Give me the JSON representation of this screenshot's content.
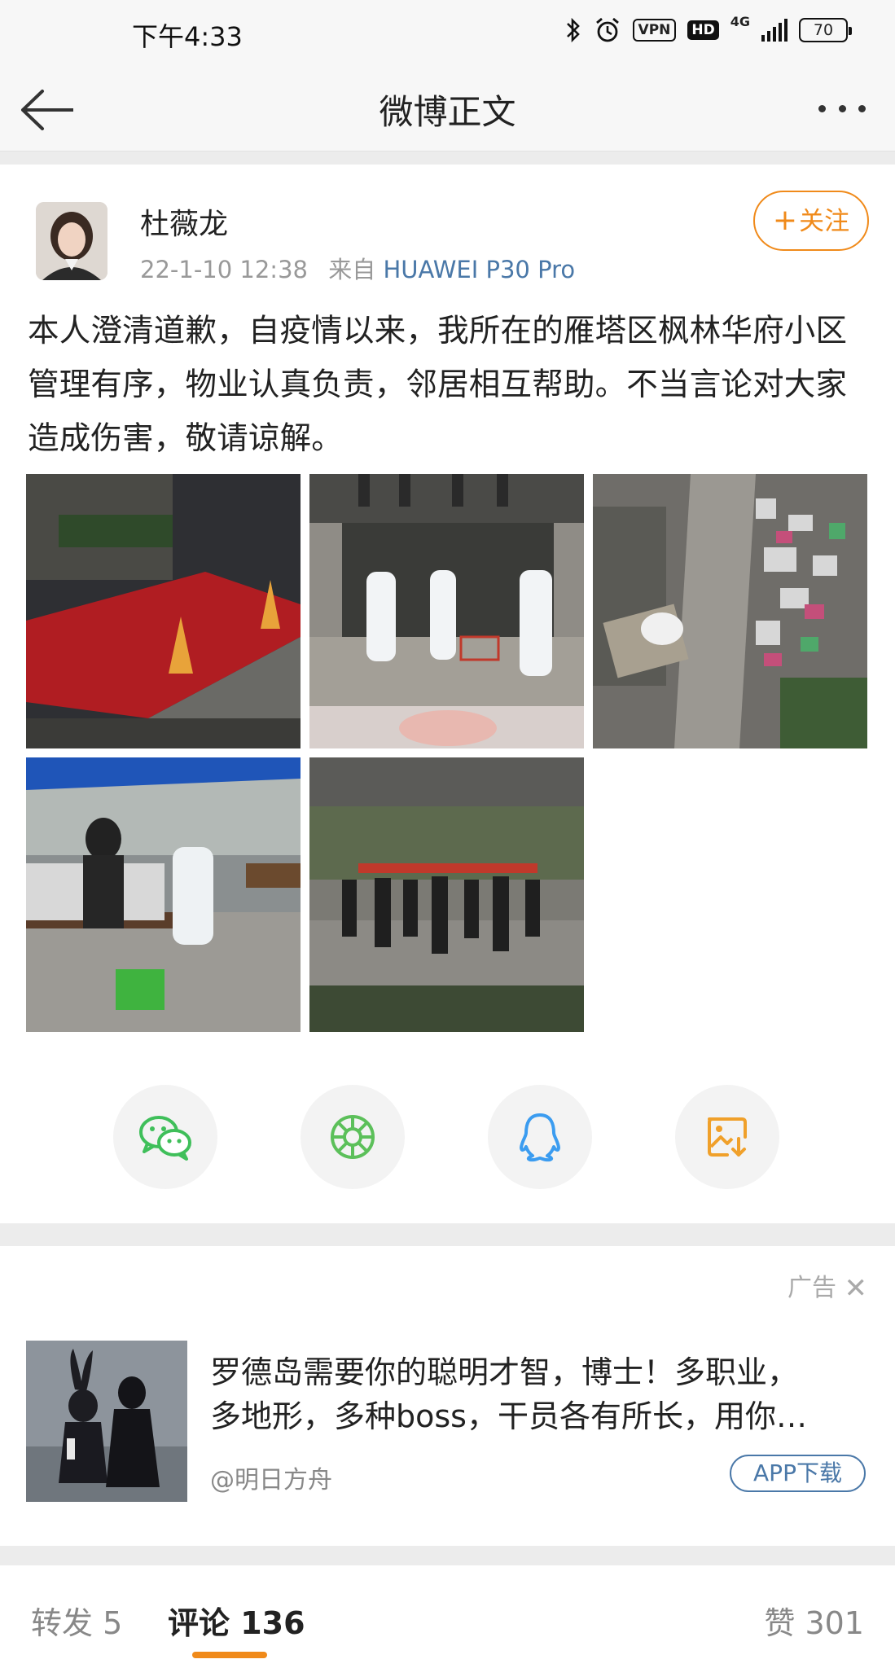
{
  "status_bar": {
    "time": "下午4:33",
    "vpn": "VPN",
    "hd": "HD",
    "network": "4G",
    "battery": "70"
  },
  "nav": {
    "title": "微博正文"
  },
  "post": {
    "author": "杜薇龙",
    "date": "22-1-10 12:38",
    "source_prefix": "来自",
    "device": "HUAWEI P30 Pro",
    "follow_label": "关注",
    "text": "本人澄清道歉，自疫情以来，我所在的雁塔区枫林华府小区管理有序，物业认真负责，邻居相互帮助。不当言论对大家造成伤害，敬请谅解。",
    "photo_count": 5
  },
  "share": {
    "icons": [
      "wechat-icon",
      "moments-icon",
      "qq-icon",
      "save-image-icon"
    ]
  },
  "ad": {
    "label": "广告",
    "text_line1": "罗德岛需要你的聪明才智，博士！多职业，",
    "text_line2": "多地形，多种boss，干员各有所长，用你…",
    "source": "@明日方舟",
    "download_label": "APP下载"
  },
  "tabs": {
    "reposts": "转发 5",
    "comments": "评论 136",
    "likes": "赞 301"
  },
  "colors": {
    "accent": "#f08a1a",
    "link": "#4a78a8",
    "wechat": "#3fbf5a"
  }
}
